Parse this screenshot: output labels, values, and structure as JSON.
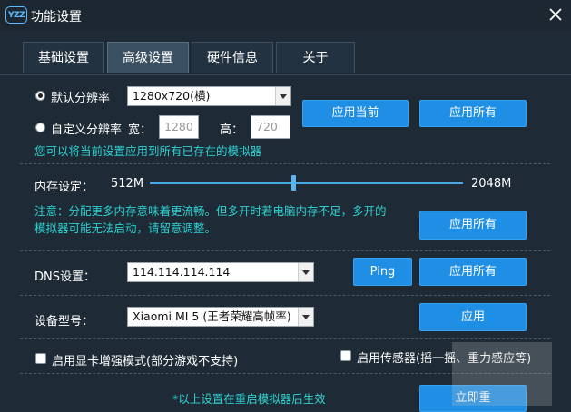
{
  "window": {
    "logo_text": "YZZ",
    "title": "功能设置"
  },
  "tabs": [
    {
      "label": "基础设置",
      "active": false
    },
    {
      "label": "高级设置",
      "active": true
    },
    {
      "label": "硬件信息",
      "active": false
    },
    {
      "label": "关于",
      "active": false
    }
  ],
  "resolution": {
    "default_label": "默认分辨率",
    "default_value": "1280x720(横)",
    "default_selected": true,
    "custom_label": "自定义分辨率",
    "width_label": "宽：",
    "width_value": "1280",
    "height_label": "高：",
    "height_value": "720",
    "apply_current": "应用当前",
    "apply_all": "应用所有",
    "note": "您可以将当前设置应用到所有已存在的模拟器"
  },
  "memory": {
    "label": "内存设定：",
    "min": "512M",
    "max": "2048M",
    "slider_fraction": 0.46,
    "note_line1": "注意：分配更多内存意味着更流畅。但多开时若电脑内存不足，多开的",
    "note_line2": "模拟器可能无法启动，请留意调整。",
    "apply_all": "应用所有"
  },
  "dns": {
    "label": "DNS设置：",
    "value": "114.114.114.114",
    "ping": "Ping",
    "apply_all": "应用所有"
  },
  "device": {
    "label": "设备型号：",
    "value": "Xiaomi MI 5 (王者荣耀高帧率)",
    "apply": "应用"
  },
  "options": {
    "gpu_boost": "启用显卡增强模式(部分游戏不支持)",
    "sensor": "启用传感器(摇一摇、重力感应等)"
  },
  "footer": {
    "note": "*以上设置在重启模拟器后生效",
    "restart": "立即重"
  },
  "colors": {
    "background": "#1e2a35",
    "accent": "#1f8fe6",
    "note": "#2fd2d2"
  }
}
